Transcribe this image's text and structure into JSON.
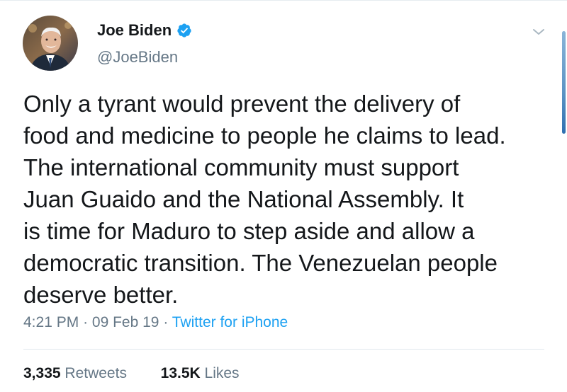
{
  "tweet": {
    "author": {
      "name": "Joe Biden",
      "handle": "@JoeBiden",
      "verified": true,
      "verified_icon": "verified-badge-icon",
      "verified_color": "#1da1f2"
    },
    "text": "Only a tyrant would prevent the delivery of\nfood and medicine to people he claims to lead.\nThe international community must support\nJuan Guaido and the National Assembly. It\nis time for Maduro to step aside and allow a\ndemocratic transition. The Venezuelan people\ndeserve better.",
    "time": "4:21 PM",
    "separator": "·",
    "date": "09 Feb 19",
    "source": "Twitter for iPhone",
    "retweets_count": "3,335",
    "retweets_label": "Retweets",
    "likes_count": "13.5K",
    "likes_label": "Likes",
    "menu_icon": "chevron-down-icon"
  },
  "colors": {
    "text": "#14171a",
    "secondary": "#657786",
    "link": "#1da1f2",
    "divider": "#e1e8ed"
  }
}
